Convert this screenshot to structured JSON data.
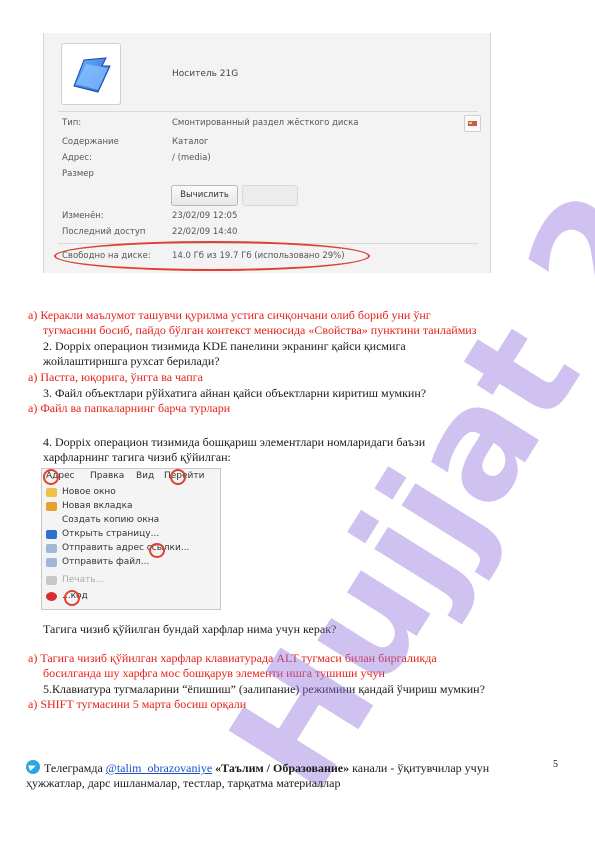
{
  "properties": {
    "device_name": "Носитель 21G",
    "rows": [
      {
        "label": "Тип:",
        "value": "Смонтированный раздел жёсткого диска"
      },
      {
        "label": "Содержание",
        "value": "Каталог"
      },
      {
        "label": "Адрес:",
        "value": "/ (media)"
      },
      {
        "label": "Размер",
        "value": ""
      },
      {
        "label": "Изменён:",
        "value": "23/02/09 12:05"
      },
      {
        "label": "Последний доступ",
        "value": "22/02/09 14:40"
      },
      {
        "label": "Свободно на диске:",
        "value": "14.0 Гб из 19.7 Гб (использовано 29%)"
      }
    ],
    "calc_button": "Вычислить",
    "icons": [
      "folder-icon",
      "drive-type-icon"
    ]
  },
  "text": {
    "a1_line1": "а)  Керакли маълумот ташувчи қурилма устига сичқончани олиб бориб уни ўнг",
    "a1_line2": "тугмасини босиб, пайдо бўлган контекст менюсида «Свойства» пунктини танлаймиз",
    "q2_line1": "2. Doppix операцион тизимида KDE панелини экранинг қайси қисмига",
    "q2_line2": "жойлаштиришга рухсат берилади?",
    "a2": "а)  Пастга, юқорига, ўнгга ва чапга",
    "q3": "3. Файл объектлари рўйхатига айнан қайси объектларни киритиш мумкин?",
    "a3": "а)  Файл ва папкаларнинг барча турлари",
    "q4_line1": "4. Doppix операцион тизимида бошқариш элементлари номларидаги баъзи",
    "q4_line2": "харфларнинг тагига чизиб қўйилган:",
    "q4_question": "Тагига чизиб қўйилган бундай харфлар нима учун керак?",
    "a4_line1": "а)  Тагига чизиб қўйилган харфлар клавиатурада ALT тугмаси билан биргаликда",
    "a4_line2": "босилганда шу харфга мос бошқарув элементи ишга тушиши учун",
    "q5": "5.Клавиатура тугмаларини “ёпишиш” (залипание) режимини қандай ўчириш мумкин?",
    "a5": "а)  SHIFT тугмасини 5 марта босиш орқали"
  },
  "menu": {
    "bar": [
      "Адрес",
      "Правка",
      "Вид",
      "Перейти"
    ],
    "items": [
      {
        "label": "Новое окно",
        "icon": "new-window-icon"
      },
      {
        "label": "Новая вкладка",
        "icon": "new-tab-icon"
      },
      {
        "label": "Создать копию окна",
        "icon": ""
      },
      {
        "label": "Открыть страницу...",
        "icon": "open-page-icon"
      },
      {
        "label": "Отправить адрес ссылки...",
        "icon": "send-link-icon"
      },
      {
        "label": "Отправить файл...",
        "icon": "send-file-icon"
      },
      {
        "label": "Печать...",
        "icon": "print-icon"
      },
      {
        "label": "...код",
        "icon": "quit-icon"
      }
    ]
  },
  "watermark": "Hujjat 24",
  "footer": {
    "prefix": "Телеграмда ",
    "link": "@talim_obrazovaniye",
    "channel": " «Таълим / Образование»",
    "suffix": " канали - ўқитувчилар учун",
    "line2": "ҳужжатлар, дарс ишланмалар, тестлар, тарқатма материаллар",
    "page_number": "5"
  }
}
